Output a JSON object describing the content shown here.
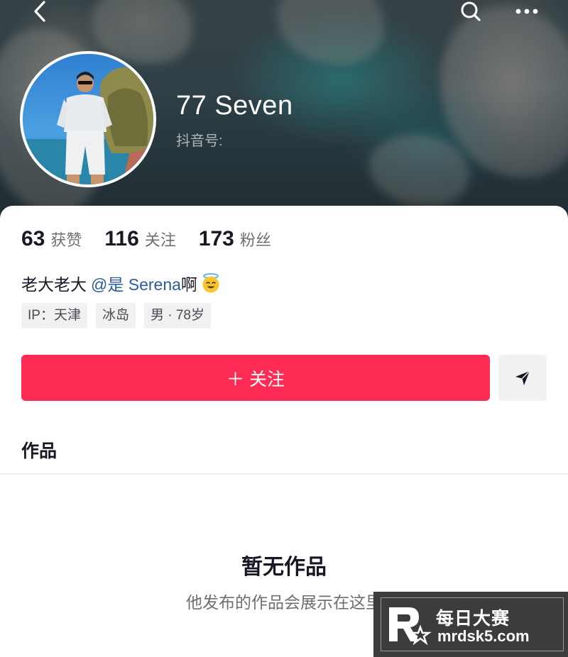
{
  "header": {
    "back_icon": "chevron-left-icon",
    "search_icon": "search-icon",
    "more_icon": "more-dots-icon"
  },
  "profile": {
    "nickname": "77 Seven",
    "douyin_id_label": "抖音号:"
  },
  "stats": [
    {
      "value": "63",
      "label": "获赞"
    },
    {
      "value": "116",
      "label": "关注"
    },
    {
      "value": "173",
      "label": "粉丝"
    }
  ],
  "bio": {
    "text": "老大老大",
    "mention": "@是 Serena",
    "mention_tail": "啊",
    "emoji": "smiling-face-with-halo-emoji"
  },
  "tags": [
    "IP：天津",
    "冰岛",
    "男 · 78岁"
  ],
  "actions": {
    "follow_label": "＋ 关注",
    "share_icon": "send-icon"
  },
  "tabs": {
    "works_label": "作品"
  },
  "empty_state": {
    "title": "暂无作品",
    "subtitle": "他发布的作品会展示在这里"
  },
  "watermark": {
    "cn": "每日大赛",
    "en": "mrdsk5.com"
  },
  "colors": {
    "accent": "#fe2c55",
    "mention": "#2a5d98",
    "text_primary": "#161823",
    "text_secondary": "#6e6f76"
  }
}
